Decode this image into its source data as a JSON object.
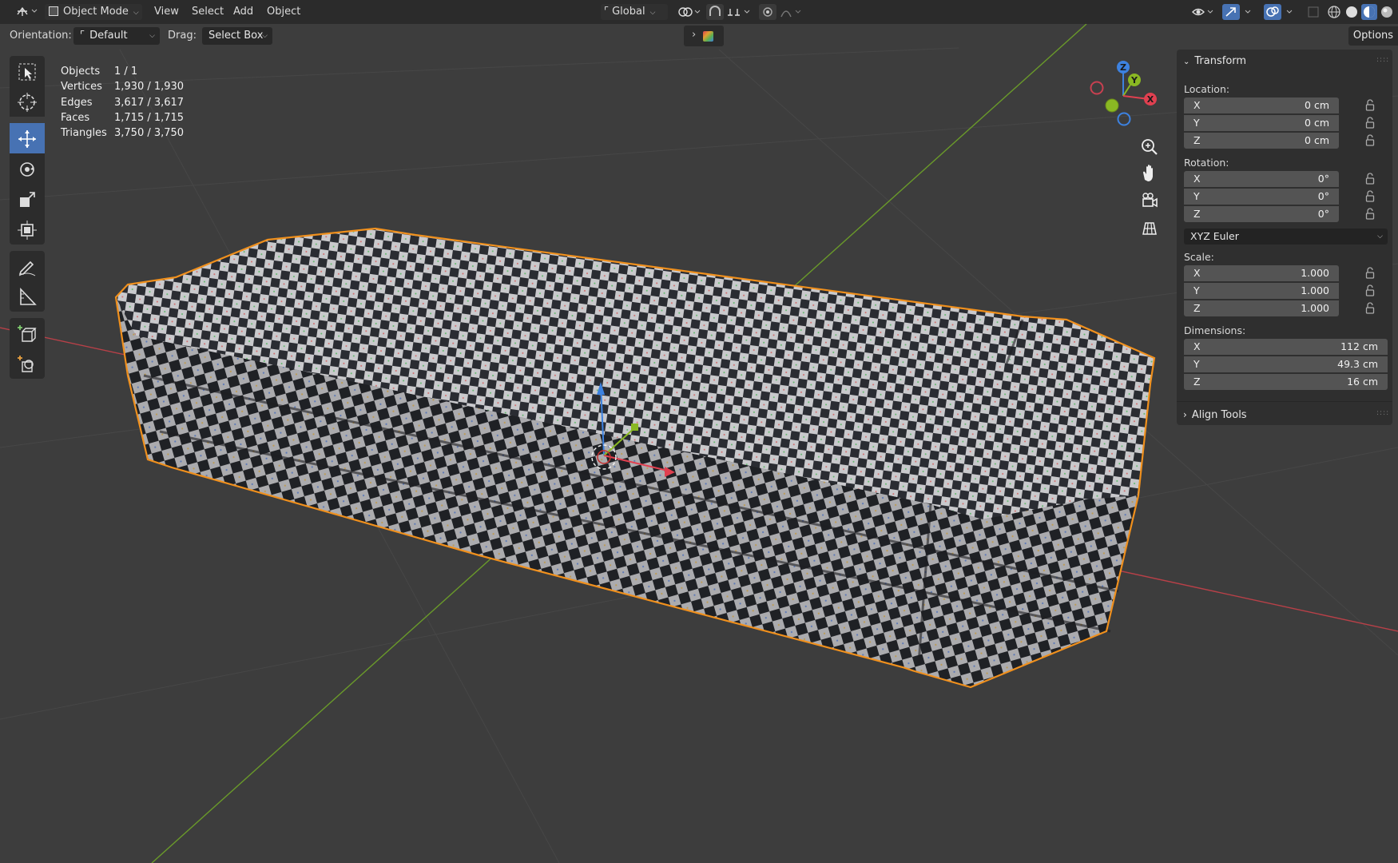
{
  "header": {
    "mode_label": "Object Mode",
    "menu": [
      "View",
      "Select",
      "Add",
      "Object"
    ],
    "transform_orientation": "Global"
  },
  "tool_settings": {
    "orientation_label": "Orientation:",
    "orientation_value": "Default",
    "drag_label": "Drag:",
    "drag_value": "Select Box",
    "options_label": "Options"
  },
  "stats": [
    {
      "label": "Objects",
      "value": "1 / 1"
    },
    {
      "label": "Vertices",
      "value": "1,930 / 1,930"
    },
    {
      "label": "Edges",
      "value": "3,617 / 3,617"
    },
    {
      "label": "Faces",
      "value": "1,715 / 1,715"
    },
    {
      "label": "Triangles",
      "value": "3,750 / 3,750"
    }
  ],
  "gizmo": {
    "z": "Z",
    "y": "Y",
    "x": "X"
  },
  "sidebar": {
    "transform_title": "Transform",
    "location_label": "Location:",
    "location": [
      {
        "axis": "X",
        "value": "0 cm"
      },
      {
        "axis": "Y",
        "value": "0 cm"
      },
      {
        "axis": "Z",
        "value": "0 cm"
      }
    ],
    "rotation_label": "Rotation:",
    "rotation": [
      {
        "axis": "X",
        "value": "0°"
      },
      {
        "axis": "Y",
        "value": "0°"
      },
      {
        "axis": "Z",
        "value": "0°"
      }
    ],
    "rotation_mode": "XYZ Euler",
    "scale_label": "Scale:",
    "scale": [
      {
        "axis": "X",
        "value": "1.000"
      },
      {
        "axis": "Y",
        "value": "1.000"
      },
      {
        "axis": "Z",
        "value": "1.000"
      }
    ],
    "dimensions_label": "Dimensions:",
    "dimensions": [
      {
        "axis": "X",
        "value": "112 cm"
      },
      {
        "axis": "Y",
        "value": "49.3 cm"
      },
      {
        "axis": "Z",
        "value": "16 cm"
      }
    ],
    "align_tools_title": "Align Tools"
  },
  "colors": {
    "accent_active": "#4772b3",
    "selection_outline": "#f0901d",
    "axis_x": "#e04050",
    "axis_y": "#8ab823",
    "axis_z": "#3d82e0"
  },
  "icons": [
    "editor-type-icon",
    "object-mode-icon",
    "transform-orientation-icon",
    "pivot-icon",
    "snap-icon",
    "proportional-icon",
    "select-box-tool-icon",
    "cursor-tool-icon",
    "move-tool-icon",
    "rotate-tool-icon",
    "scale-tool-icon",
    "transform-tool-icon",
    "annotate-tool-icon",
    "measure-tool-icon",
    "add-cube-tool-icon",
    "add-object-tool-icon",
    "zoom-icon",
    "pan-hand-icon",
    "camera-icon",
    "grid-view-icon",
    "lock-icon"
  ]
}
